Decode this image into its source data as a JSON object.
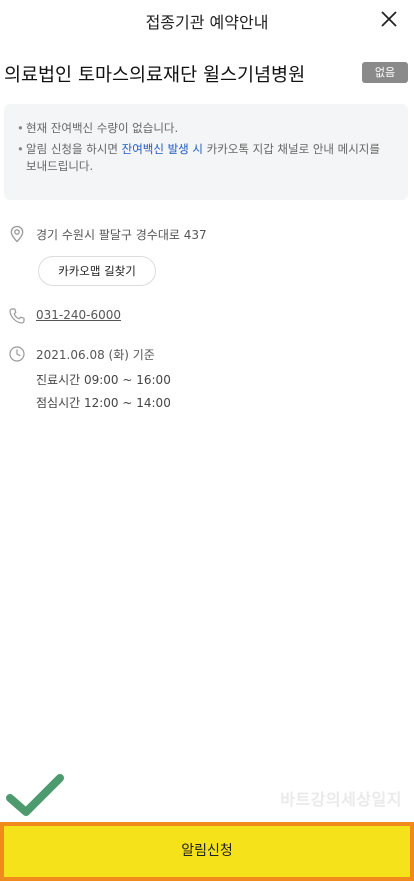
{
  "header": {
    "title": "접종기관 예약안내",
    "close_icon": "close-icon"
  },
  "hospital": {
    "name": "의료법인 토마스의료재단 윌스기념병원",
    "badge": "없음"
  },
  "notice": {
    "line1": "현재 잔여백신 수량이 없습니다.",
    "line2_pre": "알림 신청을 하시면 ",
    "line2_highlight": "잔여백신 발생 시",
    "line2_post": " 카카오톡 지갑 채널로 안내 메시지를 보내드립니다.",
    "highlight_color": "#1f5cc4"
  },
  "location": {
    "icon": "location-pin-icon",
    "address": "경기 수원시 팔달구 경수대로 437",
    "map_button": "카카오맵 길찾기"
  },
  "contact": {
    "icon": "phone-icon",
    "phone": "031-240-6000"
  },
  "hours": {
    "icon": "clock-icon",
    "date_line": "2021.06.08 (화) 기준",
    "clinic_hours": "진료시간 09:00 ~ 16:00",
    "lunch_hours": "점심시간 12:00 ~ 14:00"
  },
  "overlay": {
    "check_icon": "checkmark-icon",
    "watermark": "바트강의세상일지"
  },
  "footer": {
    "apply_label": "알림신청",
    "button_color": "#f6e21a",
    "border_color": "#f08a1c"
  }
}
